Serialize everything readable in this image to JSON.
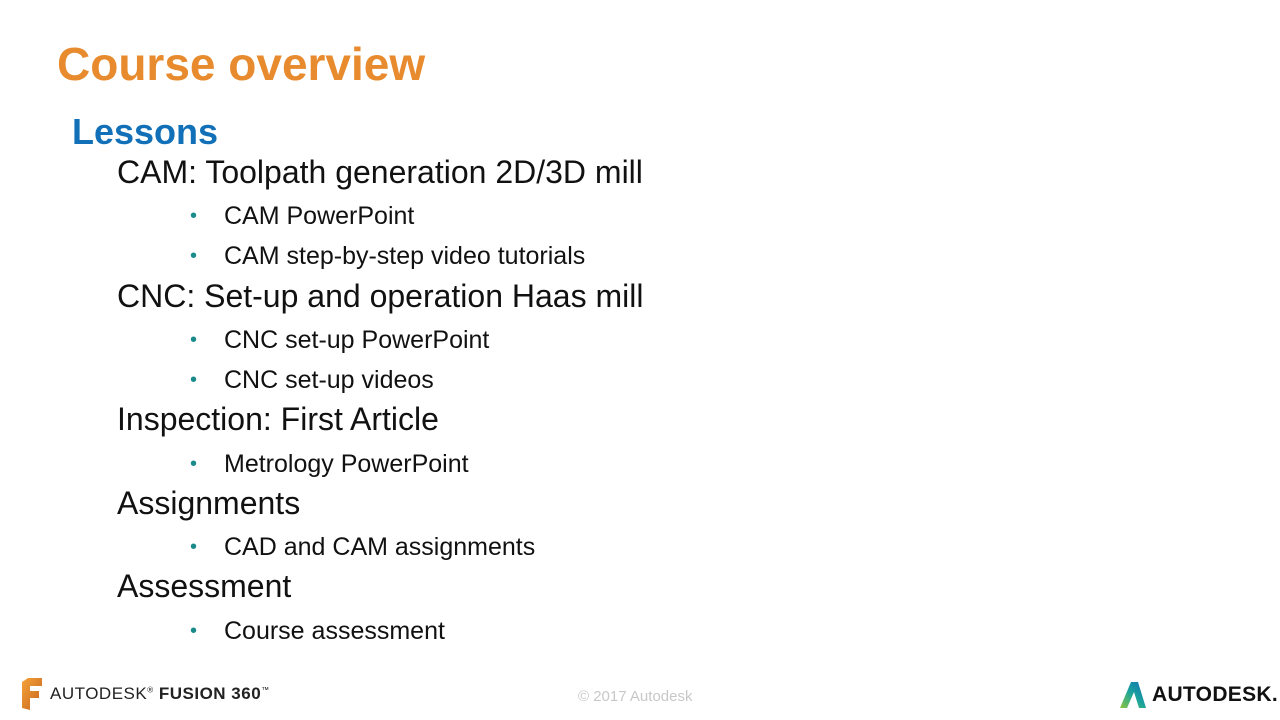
{
  "title": "Course overview",
  "subtitle": "Lessons",
  "sections": [
    {
      "heading": "CAM: Toolpath generation 2D/3D mill",
      "bullets": [
        "CAM PowerPoint",
        "CAM step-by-step video tutorials"
      ]
    },
    {
      "heading": "CNC: Set-up and operation Haas mill",
      "bullets": [
        "CNC set-up PowerPoint",
        "CNC set-up videos"
      ]
    },
    {
      "heading": "Inspection: First Article",
      "bullets": [
        "Metrology PowerPoint"
      ]
    },
    {
      "heading": "Assignments",
      "bullets": [
        "CAD and CAM assignments"
      ]
    },
    {
      "heading": "Assessment",
      "bullets": [
        "Course assessment"
      ]
    }
  ],
  "footer": {
    "left_brand": "AUTODESK",
    "left_product": "FUSION 360",
    "left_tm": "™",
    "left_reg": "®",
    "copyright": "© 2017 Autodesk",
    "right_brand": "AUTODESK."
  },
  "colors": {
    "title": "#E88B2E",
    "subtitle": "#1170B8",
    "bullet": "#1a8a8a"
  }
}
